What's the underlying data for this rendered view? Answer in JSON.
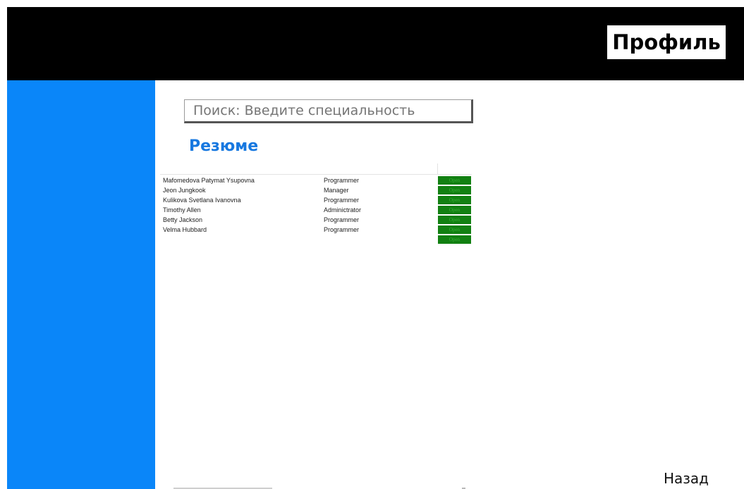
{
  "header": {
    "profile_label": "Профиль"
  },
  "search": {
    "placeholder": "Поиск: Введите специальность"
  },
  "resume": {
    "title": "Резюме",
    "rows": [
      {
        "name": "Mafomedova Patymat Ysupovna",
        "position": "Programmer",
        "action": "Open"
      },
      {
        "name": "Jeon Jungkook",
        "position": "Manager",
        "action": "Open"
      },
      {
        "name": "Kulikova Svetlana Ivanovna",
        "position": "Programmer",
        "action": "Open"
      },
      {
        "name": "Timothy Allen",
        "position": "Adminictrator",
        "action": "Open"
      },
      {
        "name": "Betty Jackson",
        "position": "Programmer",
        "action": "Open"
      },
      {
        "name": "Velma Hubbard",
        "position": "Programmer",
        "action": "Open"
      },
      {
        "name": "",
        "position": "",
        "action": "Open"
      }
    ]
  },
  "footer": {
    "back_label": "Назад"
  },
  "colors": {
    "header_bg": "#000000",
    "sidebar_bg": "#0a86f9",
    "title_blue": "#1778e0",
    "open_button_bg": "#128012"
  }
}
